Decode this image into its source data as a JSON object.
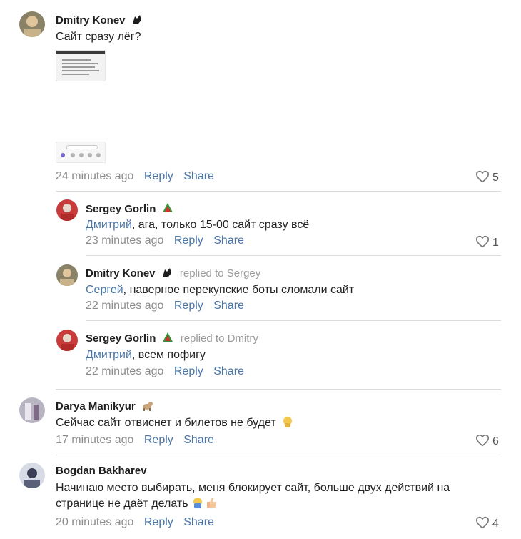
{
  "comments": [
    {
      "author": "Dmitry Konev",
      "badge_icon": "wolf-head-icon",
      "text": "Сайт сразу лёг?",
      "time": "24 minutes ago",
      "reply_label": "Reply",
      "share_label": "Share",
      "likes": "5",
      "replies": [
        {
          "author": "Sergey Gorlin",
          "badge_icon": "locomotive-club-icon",
          "mention": "Дмитрий",
          "text": ", ага, только 15-00 сайт сразу всё",
          "time": "23 minutes ago",
          "reply_label": "Reply",
          "share_label": "Share",
          "likes": "1"
        },
        {
          "author": "Dmitry Konev",
          "badge_icon": "wolf-head-icon",
          "replied_to": "replied to Sergey",
          "mention": "Сергей",
          "text": ", наверное перекупские боты сломали сайт",
          "time": "22 minutes ago",
          "reply_label": "Reply",
          "share_label": "Share"
        },
        {
          "author": "Sergey Gorlin",
          "badge_icon": "locomotive-club-icon",
          "replied_to": "replied to Dmitry",
          "mention": "Дмитрий",
          "text": ", всем пофигу",
          "time": "22 minutes ago",
          "reply_label": "Reply",
          "share_label": "Share"
        }
      ]
    },
    {
      "author": "Darya Manikyur",
      "badge_icon": "dog-emoji-icon",
      "text": "Сейчас сайт отвиснет и билетов не будет",
      "time": "17 minutes ago",
      "reply_label": "Reply",
      "share_label": "Share",
      "likes": "6"
    },
    {
      "author": "Bogdan Bakharev",
      "text_line1": "Начинаю место выбирать, меня блокирует сайт, больше двух действий на",
      "text_line2": "странице не даёт делать",
      "time": "20 minutes ago",
      "reply_label": "Reply",
      "share_label": "Share",
      "likes": "4"
    }
  ],
  "colors": {
    "link": "#4a76a8",
    "meta": "#8c8c8c",
    "divider": "#dcdcdc"
  }
}
